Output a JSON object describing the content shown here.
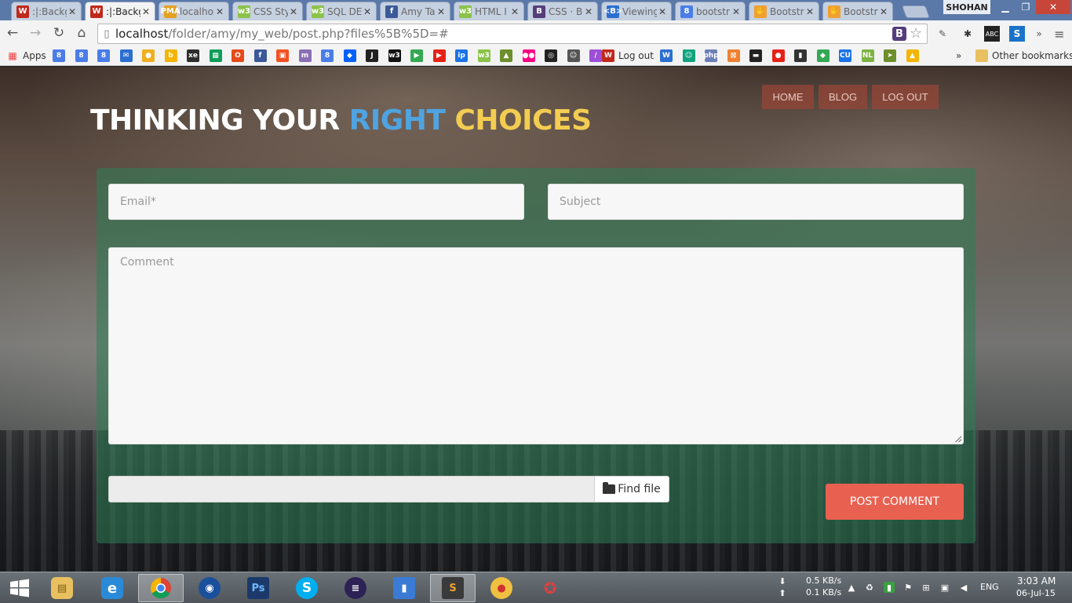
{
  "browser": {
    "tabs": [
      {
        "label": ":|:Backg",
        "icon": "W",
        "icon_color": "#c0281c"
      },
      {
        "label": ":|:Backg",
        "icon": "W",
        "icon_color": "#c0281c"
      },
      {
        "label": "localho",
        "icon": "PMA",
        "icon_color": "#e6a020"
      },
      {
        "label": "CSS Sty",
        "icon": "w3",
        "icon_color": "#8bc34a"
      },
      {
        "label": "SQL DE",
        "icon": "w3",
        "icon_color": "#8bc34a"
      },
      {
        "label": "Amy Ta",
        "icon": "f",
        "icon_color": "#3b5998"
      },
      {
        "label": "HTML I",
        "icon": "w3",
        "icon_color": "#8bc34a"
      },
      {
        "label": "CSS · B",
        "icon": "B",
        "icon_color": "#563d7c"
      },
      {
        "label": "Viewing",
        "icon": "<B>",
        "icon_color": "#2a6fd0"
      },
      {
        "label": "bootstr",
        "icon": "8",
        "icon_color": "#4a7de8"
      },
      {
        "label": "Bootstr",
        "icon": "✋",
        "icon_color": "#f0a030"
      },
      {
        "label": "Bootstr",
        "icon": "✋",
        "icon_color": "#f0a030"
      }
    ],
    "user_name": "SHOHAN",
    "url_host": "localhost",
    "url_path": "/folder/amy/my_web/post.php?files%5B%5D=#",
    "bookmarks": {
      "apps_label": "Apps",
      "logout_label": "Log out",
      "other_label": "Other bookmarks",
      "overflow": "»",
      "icons": [
        {
          "glyph": "8",
          "color": "#4a7de8"
        },
        {
          "glyph": "8",
          "color": "#4a7de8"
        },
        {
          "glyph": "8",
          "color": "#4a7de8"
        },
        {
          "glyph": "✉",
          "color": "#2a6fd0"
        },
        {
          "glyph": "●",
          "color": "#f0b020"
        },
        {
          "glyph": "b",
          "color": "#f4b400"
        },
        {
          "glyph": "xe",
          "color": "#2d2d2d"
        },
        {
          "glyph": "▦",
          "color": "#0f9d58"
        },
        {
          "glyph": "O",
          "color": "#e64a19"
        },
        {
          "glyph": "f",
          "color": "#3b5998"
        },
        {
          "glyph": "▣",
          "color": "#f25022"
        },
        {
          "glyph": "m",
          "color": "#8a6fb5"
        },
        {
          "glyph": "8",
          "color": "#4a7de8"
        },
        {
          "glyph": "◆",
          "color": "#0061fe"
        },
        {
          "glyph": "J",
          "color": "#222222"
        },
        {
          "glyph": "w3",
          "color": "#111111"
        },
        {
          "glyph": "▶",
          "color": "#34a853"
        },
        {
          "glyph": "▶",
          "color": "#e62117"
        },
        {
          "glyph": "ip",
          "color": "#1a73e8"
        },
        {
          "glyph": "w3",
          "color": "#8bc34a"
        },
        {
          "glyph": "▲",
          "color": "#6d8f2c"
        },
        {
          "glyph": "●●",
          "color": "#ff0084"
        },
        {
          "glyph": "◎",
          "color": "#222222"
        },
        {
          "glyph": "☺",
          "color": "#555555"
        },
        {
          "glyph": "/",
          "color": "#9c4fd8"
        }
      ],
      "icons_after": [
        {
          "glyph": "W",
          "color": "#2a6fd0"
        },
        {
          "glyph": "☺",
          "color": "#0fa37f"
        },
        {
          "glyph": "php",
          "color": "#6c7eb7"
        },
        {
          "glyph": "⊠",
          "color": "#f08030"
        },
        {
          "glyph": "▬",
          "color": "#222222"
        },
        {
          "glyph": "●",
          "color": "#e62117"
        },
        {
          "glyph": "▮",
          "color": "#333333"
        },
        {
          "glyph": "◆",
          "color": "#34a853"
        },
        {
          "glyph": "CU",
          "color": "#1a73e8"
        },
        {
          "glyph": "NL",
          "color": "#7cb342"
        },
        {
          "glyph": "➤",
          "color": "#6d8f2c"
        },
        {
          "glyph": "▲",
          "color": "#f4b400"
        }
      ]
    }
  },
  "site": {
    "nav": [
      "HOME",
      "BLOG",
      "LOG OUT"
    ],
    "headline": {
      "part1": "THINKING YOUR",
      "part2": "RIGHT",
      "part3": "CHOICES"
    },
    "form": {
      "email_placeholder": "Email*",
      "subject_placeholder": "Subject",
      "comment_placeholder": "Comment",
      "find_file_label": "Find file",
      "post_button": "POST COMMENT"
    },
    "colors": {
      "accent_red": "#e8604f",
      "title_blue": "#4fa3e0",
      "title_yellow": "#f3cd52",
      "panel_green": "#2d7d55"
    }
  },
  "taskbar": {
    "net_down": "0.5 KB/s",
    "net_up": "0.1 KB/s",
    "language": "ENG",
    "time": "3:03 AM",
    "date": "06-Jul-15"
  }
}
